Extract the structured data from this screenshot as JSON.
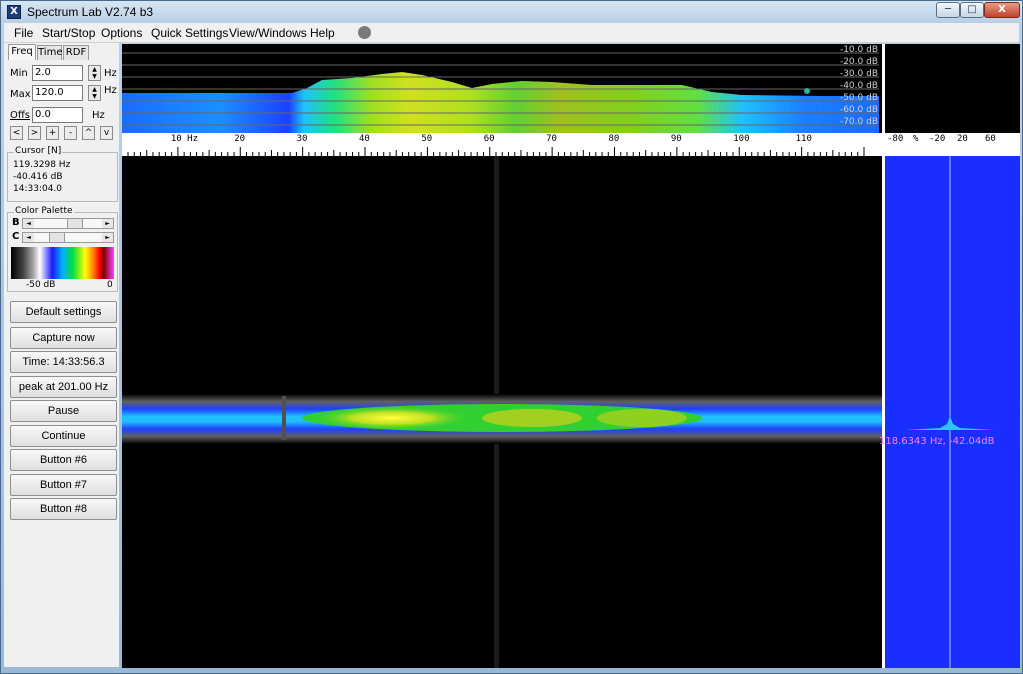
{
  "window": {
    "title": "Spectrum Lab V2.74 b3",
    "icon_glyph": "X",
    "min_glyph": "─",
    "max_glyph": "□",
    "close_glyph": "X"
  },
  "menu": [
    "File",
    "Start/Stop",
    "Options",
    "Quick Settings",
    "View/Windows",
    "Help"
  ],
  "tabs": [
    "Freq",
    "Time",
    "RDF"
  ],
  "freq": {
    "min_label": "Min",
    "min_value": "2.0",
    "max_label": "Max",
    "max_value": "120.0",
    "offs_label": "Offs",
    "offs_value": "0.0",
    "unit": "Hz",
    "spin_up": "▲",
    "spin_down": "▼",
    "nav_buttons": [
      "<",
      ">",
      "+",
      "-",
      "^",
      "v"
    ]
  },
  "cursor": {
    "title": "Cursor [N]",
    "freq": "119.3298 Hz",
    "level": "-40.416 dB",
    "time": "14:33:04.0"
  },
  "palette": {
    "title": "Color Palette",
    "b_label": "B",
    "c_label": "C",
    "left_arrow": "◄",
    "right_arrow": "►",
    "min_label": "-50 dB",
    "max_label": "0"
  },
  "buttons": [
    "Default settings",
    "Capture now",
    "Time:  14:33:56.3",
    "peak at 201.00 Hz",
    "Pause",
    "Continue",
    "Button #6",
    "Button #7",
    "Button #8"
  ],
  "spectrum": {
    "db_labels": [
      "-10.0 dB",
      "-20.0 dB",
      "-30.0 dB",
      "-40.0 dB",
      "-50.0 dB",
      "-60.0 dB",
      "-70.0 dB"
    ],
    "freq_ticks": [
      "10 Hz",
      "20",
      "30",
      "40",
      "50",
      "60",
      "70",
      "80",
      "90",
      "100",
      "110"
    ],
    "freq_tick_values": [
      10,
      20,
      30,
      40,
      50,
      60,
      70,
      80,
      90,
      100,
      110
    ],
    "freq_range": [
      2,
      120
    ]
  },
  "right_scale": {
    "ticks": [
      "-80",
      "%",
      "-20",
      "20",
      "60"
    ]
  },
  "peak_readout": "118.6343 Hz, -42.04dB",
  "colors": {
    "display_bg": "#000000",
    "right_panel": "#1a2eff",
    "peak_text": "#ff7fff"
  }
}
